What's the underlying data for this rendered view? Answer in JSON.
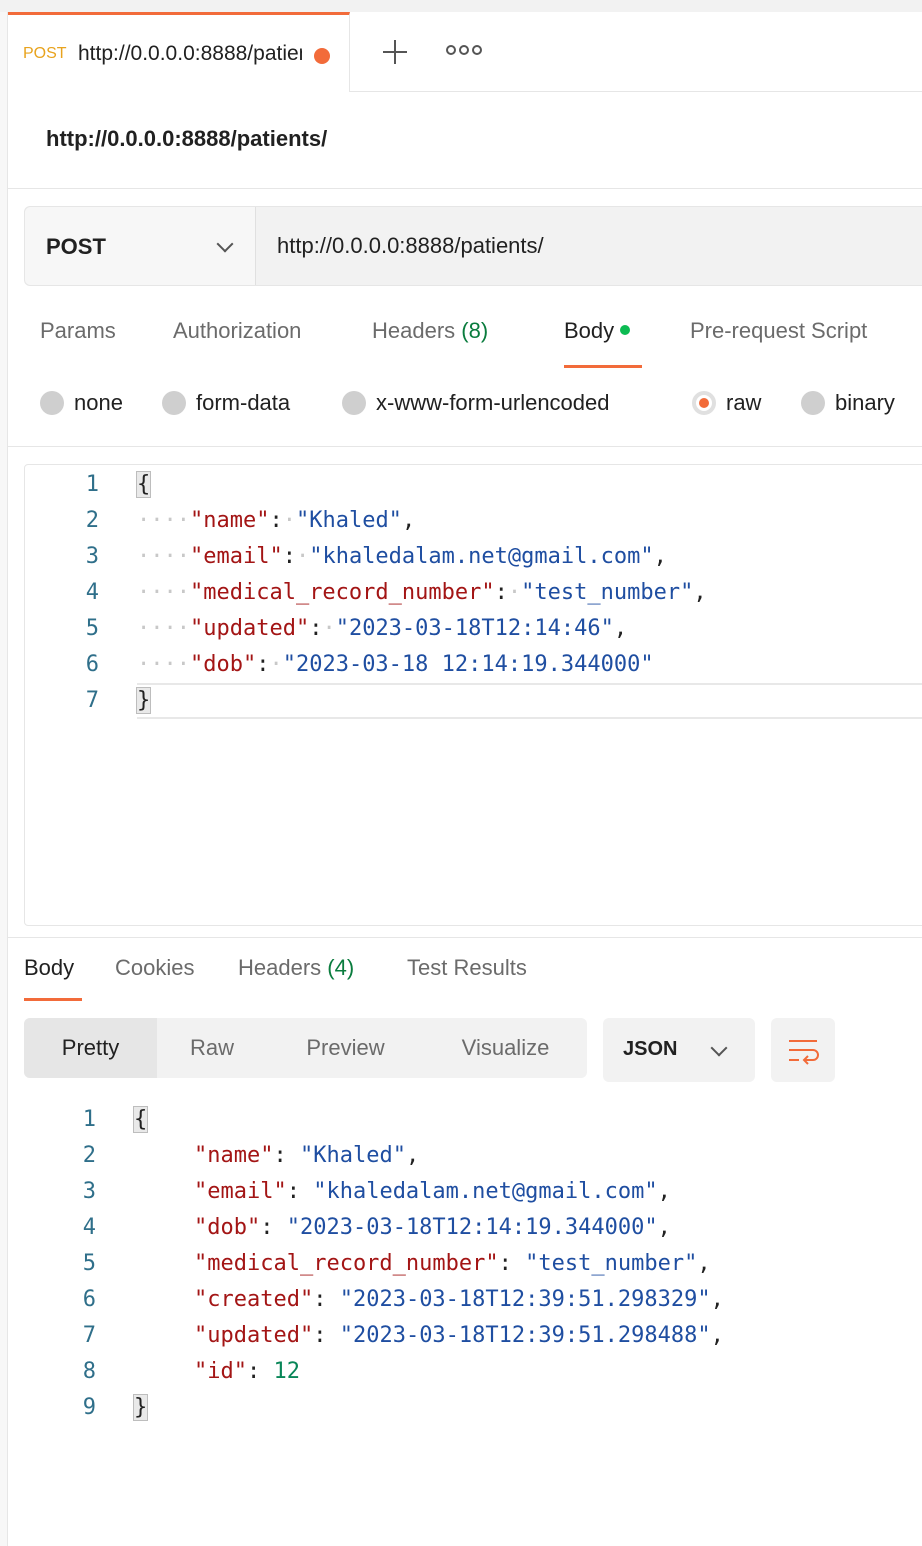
{
  "colors": {
    "accent": "#f26b3a",
    "method_tab": "#e8a31e",
    "count_green": "#0a7c3e",
    "json_key": "#a31515",
    "json_string": "#1f4ea1",
    "json_number": "#098658"
  },
  "tab": {
    "method": "POST",
    "url": "http://0.0.0.0:8888/patients/",
    "unsaved_icon": "dot-icon"
  },
  "tabbar": {
    "new_tab_icon": "plus-icon",
    "more_icon": "ellipsis-icon"
  },
  "page_title": "http://0.0.0.0:8888/patients/",
  "request": {
    "method": "POST",
    "url": "http://0.0.0.0:8888/patients/"
  },
  "request_tabs": [
    {
      "label": "Params"
    },
    {
      "label": "Authorization"
    },
    {
      "label": "Headers",
      "count": "(8)"
    },
    {
      "label": "Body",
      "active": true
    },
    {
      "label": "Pre-request Script"
    }
  ],
  "body_types": [
    "none",
    "form-data",
    "x-www-form-urlencoded",
    "raw",
    "binary"
  ],
  "body_type_selected": "raw",
  "request_body": {
    "line_numbers": [
      "1",
      "2",
      "3",
      "4",
      "5",
      "6",
      "7"
    ],
    "open": "{",
    "close": "}",
    "lines": [
      {
        "key": "\"name\"",
        "value": "\"Khaled\"",
        "trail": ","
      },
      {
        "key": "\"email\"",
        "value": "\"khaledalam.net@gmail.com\"",
        "trail": ","
      },
      {
        "key": "\"medical_record_number\"",
        "value": "\"test_number\"",
        "trail": ","
      },
      {
        "key": "\"updated\"",
        "value": "\"2023-03-18T12:14:46\"",
        "trail": ","
      },
      {
        "key": "\"dob\"",
        "value": "\"2023-03-18 12:14:19.344000\"",
        "trail": ""
      }
    ]
  },
  "response_tabs": [
    {
      "label": "Body",
      "active": true
    },
    {
      "label": "Cookies"
    },
    {
      "label": "Headers",
      "count": "(4)"
    },
    {
      "label": "Test Results"
    }
  ],
  "view_modes": [
    "Pretty",
    "Raw",
    "Preview",
    "Visualize"
  ],
  "view_mode_selected": "Pretty",
  "format": "JSON",
  "wrap_icon": "wrap-lines-icon",
  "response_body": {
    "line_numbers": [
      "1",
      "2",
      "3",
      "4",
      "5",
      "6",
      "7",
      "8",
      "9"
    ],
    "open": "{",
    "close": "}",
    "lines": [
      {
        "key": "\"name\"",
        "value": "\"Khaled\"",
        "trail": ","
      },
      {
        "key": "\"email\"",
        "value": "\"khaledalam.net@gmail.com\"",
        "trail": ","
      },
      {
        "key": "\"dob\"",
        "value": "\"2023-03-18T12:14:19.344000\"",
        "trail": ","
      },
      {
        "key": "\"medical_record_number\"",
        "value": "\"test_number\"",
        "trail": ","
      },
      {
        "key": "\"created\"",
        "value": "\"2023-03-18T12:39:51.298329\"",
        "trail": ","
      },
      {
        "key": "\"updated\"",
        "value": "\"2023-03-18T12:39:51.298488\"",
        "trail": ","
      },
      {
        "key": "\"id\"",
        "value": "12",
        "trail": "",
        "numeric": true
      }
    ]
  }
}
